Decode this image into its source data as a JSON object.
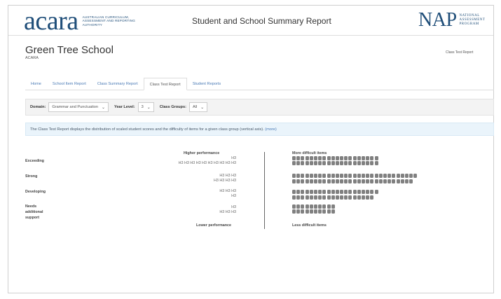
{
  "header": {
    "acara_word": "acara",
    "acara_sub": "Australian Curriculum, Assessment and Reporting Authority",
    "title": "Student and School Summary Report",
    "nap_word": "NAP",
    "nap_sub": "National Assessment Program"
  },
  "school": {
    "name": "Green Tree School",
    "sub": "ACARA",
    "top_right_link": "Class Test Report"
  },
  "tabs": [
    {
      "label": "Home"
    },
    {
      "label": "School Item Report"
    },
    {
      "label": "Class Summary Report"
    },
    {
      "label": "Class Test Report",
      "active": true
    },
    {
      "label": "Student Reports"
    }
  ],
  "filters": {
    "domain_label": "Domain:",
    "domain_value": "Grammar and Punctuation",
    "year_label": "Year Level:",
    "year_value": "3",
    "group_label": "Class Groups:",
    "group_value": "All"
  },
  "info": {
    "text": "The Class Test Report displays the distribution of scaled student scores and the difficulty of items for a given class group (vertical axis).",
    "more": "(more)"
  },
  "report": {
    "higher_performance": "Higher performance",
    "lower_performance": "Lower performance",
    "more_difficult": "More difficult items",
    "less_difficult": "Less difficult items",
    "bands": [
      {
        "label": "Exceeding",
        "students": [
          "H3",
          "H3 H3 H3 H3 H3 H3 H3 H3 H3 H3"
        ],
        "items": [
          20,
          20
        ]
      },
      {
        "label": "Strong",
        "students": [
          "H3 H3 H3",
          "H3 H3 H3 H3"
        ],
        "items": [
          29,
          28
        ]
      },
      {
        "label": "Developing",
        "students": [
          "H3 H3 H3",
          "H3"
        ],
        "items": [
          20,
          19
        ]
      },
      {
        "label": "Needs additional support",
        "students": [
          "H3",
          "H3 H3 H3"
        ],
        "items": [
          10,
          10
        ]
      }
    ]
  },
  "colors": {
    "brand": "#1f4e79",
    "link": "#4a7ab5",
    "dot": "#808080"
  }
}
